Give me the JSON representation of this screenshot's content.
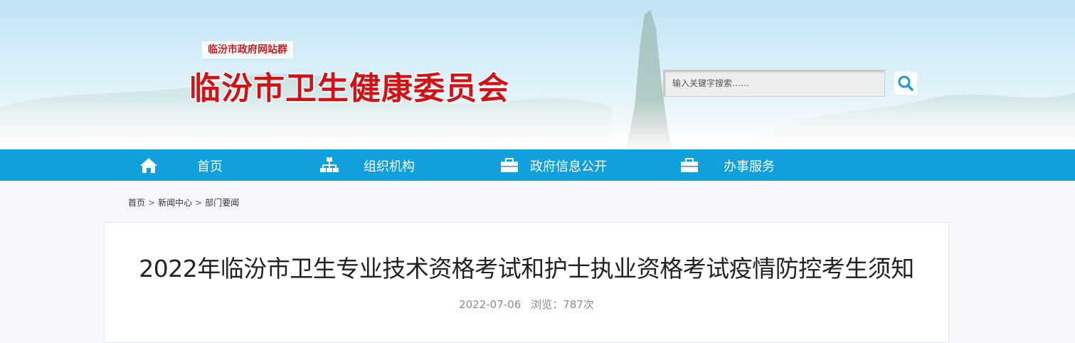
{
  "header": {
    "site_group": "临汾市政府网站群",
    "site_title": "临汾市卫生健康委员会",
    "search": {
      "placeholder": "输入关键字搜索……",
      "button_icon": "search-icon"
    }
  },
  "nav": {
    "items": [
      {
        "label": "首页",
        "icon": "home-icon"
      },
      {
        "label": "组织机构",
        "icon": "org-chart-icon"
      },
      {
        "label": "政府信息公开",
        "icon": "briefcase-icon"
      },
      {
        "label": "办事服务",
        "icon": "briefcase-icon"
      }
    ]
  },
  "breadcrumb": [
    "首页",
    "新闻中心",
    "部门要闻"
  ],
  "article": {
    "title": "2022年临汾市卫生专业技术资格考试和护士执业资格考试疫情防控考生须知",
    "date": "2022-07-06",
    "views": "浏览：787次"
  },
  "colors": {
    "nav_bg": "#10a0dc",
    "title_red": "#d21316",
    "accent_blue": "#1a9bd8"
  }
}
